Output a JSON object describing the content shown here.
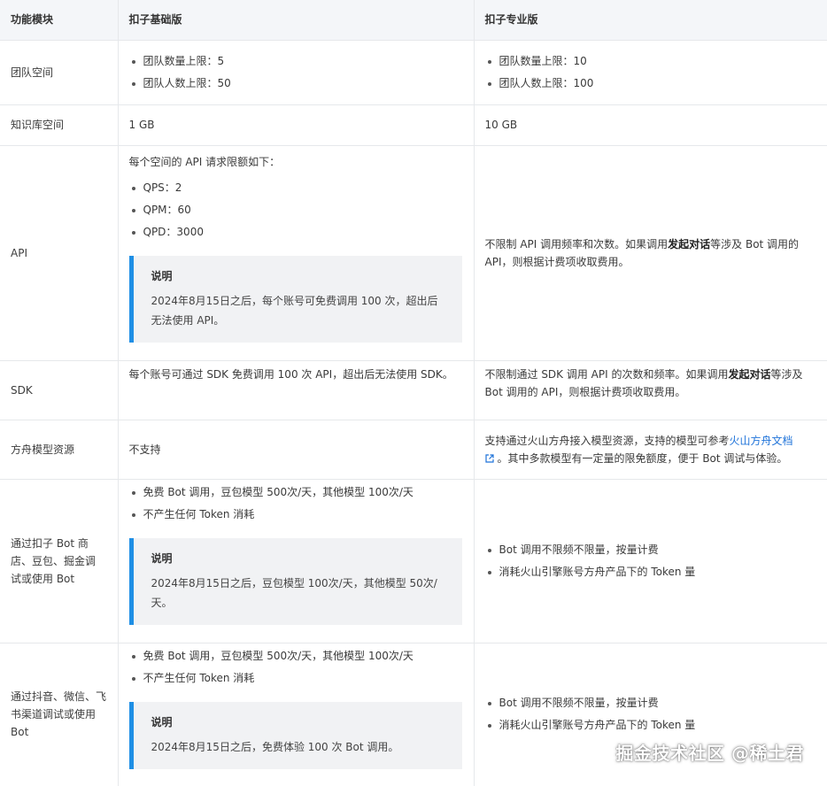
{
  "headers": [
    "功能模块",
    "扣子基础版",
    "扣子专业版"
  ],
  "rows": {
    "team": {
      "label": "团队空间",
      "basic": [
        "团队数量上限：5",
        "团队人数上限：50"
      ],
      "pro": [
        "团队数量上限：10",
        "团队人数上限：100"
      ]
    },
    "kb": {
      "label": "知识库空间",
      "basic": "1 GB",
      "pro": "10 GB"
    },
    "api": {
      "label": "API",
      "basic_intro": "每个空间的 API 请求限额如下：",
      "basic_items": [
        "QPS：2",
        "QPM：60",
        "QPD：3000"
      ],
      "note_title": "说明",
      "note_body": "2024年8月15日之后，每个账号可免费调用 100 次，超出后无法使用 API。",
      "pro_a": "不限制 API 调用频率和次数。如果调用",
      "pro_bold": "发起对话",
      "pro_b": "等涉及 Bot 调用的 API，则根据计费项收取费用。"
    },
    "sdk": {
      "label": "SDK",
      "basic": "每个账号可通过 SDK 免费调用 100 次 API，超出后无法使用 SDK。",
      "pro_a": "不限制通过 SDK 调用 API 的次数和频率。如果调用",
      "pro_bold": "发起对话",
      "pro_b": "等涉及 Bot 调用的 API，则根据计费项收取费用。"
    },
    "ark": {
      "label": "方舟模型资源",
      "basic": "不支持",
      "pro_a": "支持通过火山方舟接入模型资源，支持的模型可参考",
      "pro_link": "火山方舟文档",
      "pro_b": "。其中多款模型有一定量的限免额度，便于 Bot 调试与体验。"
    },
    "store": {
      "label": "通过扣子 Bot 商店、豆包、掘金调试或使用 Bot",
      "basic_items": [
        "免费 Bot 调用，豆包模型 500次/天，其他模型 100次/天",
        "不产生任何 Token 消耗"
      ],
      "note_title": "说明",
      "note_body": "2024年8月15日之后，豆包模型 100次/天，其他模型 50次/天。",
      "pro_items": [
        "Bot 调用不限频不限量，按量计费",
        "消耗火山引擎账号方舟产品下的 Token 量"
      ]
    },
    "channel": {
      "label": "通过抖音、微信、飞书渠道调试或使用 Bot",
      "basic_items": [
        "免费 Bot 调用，豆包模型 500次/天，其他模型 100次/天",
        "不产生任何 Token 消耗"
      ],
      "note_title": "说明",
      "note_body": "2024年8月15日之后，免费体验 100 次 Bot 调用。",
      "pro_items": [
        "Bot 调用不限频不限量，按量计费",
        "消耗火山引擎账号方舟产品下的 Token 量"
      ]
    }
  },
  "watermark": "掘金技术社区 @稀土君",
  "colors": {
    "accent": "#1f8fe5",
    "header_bg": "#f4f6f9",
    "note_bg": "#f1f2f4",
    "link": "#1f73d9"
  }
}
